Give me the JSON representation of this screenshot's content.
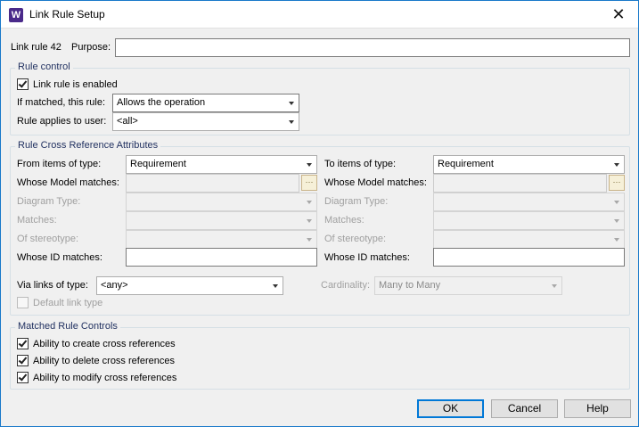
{
  "window": {
    "title": "Link Rule Setup",
    "app_icon_letter": "W"
  },
  "header": {
    "rule_label": "Link rule 42",
    "purpose_label": "Purpose:",
    "purpose_value": ""
  },
  "rule_control": {
    "title": "Rule control",
    "enabled_label": "Link rule is enabled",
    "enabled_checked": true,
    "if_matched_label": "If matched, this rule:",
    "if_matched_value": "Allows the operation",
    "applies_label": "Rule applies to user:",
    "applies_value": "<all>"
  },
  "attributes": {
    "title": "Rule Cross Reference Attributes",
    "from": {
      "type_label": "From items of type:",
      "type_value": "Requirement",
      "model_label": "Whose Model matches:",
      "diagram_label": "Diagram Type:",
      "matches_label": "Matches:",
      "stereotype_label": "Of stereotype:",
      "id_label": "Whose ID matches:"
    },
    "to": {
      "type_label": "To items of type:",
      "type_value": "Requirement",
      "model_label": "Whose Model matches:",
      "diagram_label": "Diagram Type:",
      "matches_label": "Matches:",
      "stereotype_label": "Of stereotype:",
      "id_label": "Whose ID matches:"
    },
    "via_label": "Via links of type:",
    "via_value": "<any>",
    "cardinality_label": "Cardinality:",
    "cardinality_value": "Many to Many",
    "default_link_label": "Default link type"
  },
  "matched": {
    "title": "Matched Rule Controls",
    "create_label": "Ability to create cross references",
    "delete_label": "Ability to delete cross references",
    "modify_label": "Ability to modify cross references"
  },
  "buttons": {
    "ok": "OK",
    "cancel": "Cancel",
    "help": "Help"
  },
  "icons": {
    "browse": "browse-icon",
    "close": "close-icon",
    "app": "app-icon"
  }
}
